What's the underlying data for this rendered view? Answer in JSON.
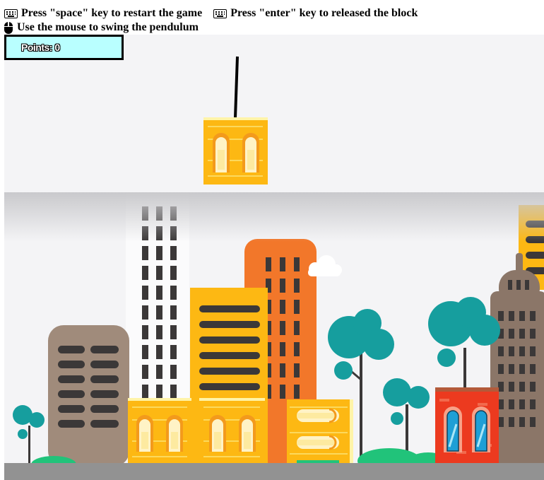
{
  "instructions": {
    "restart": "Press \"space\" key to restart the game",
    "release": "Press \"enter\" key to released the block",
    "swing": "Use the mouse to swing the pendulum"
  },
  "icons": {
    "keyboard": "keyboard-icon",
    "mouse": "mouse-icon"
  },
  "score": {
    "label": "Points: 0",
    "value": 0
  },
  "colors": {
    "score_bg": "#b9ffff",
    "sky": "#f4f4f6",
    "ground": "#929292",
    "block_yellow": "#fdb813",
    "block_red": "#ec3a1f",
    "building_orange": "#f2772a",
    "building_brown": "#a08b7b",
    "tree_teal": "#169e9e"
  },
  "stacked_blocks": [
    {
      "style": "window-block",
      "color": "yellow"
    },
    {
      "style": "window-block",
      "color": "yellow"
    },
    {
      "style": "capsule-block",
      "color": "yellow"
    }
  ],
  "swinging_block": {
    "style": "window-block",
    "color": "yellow"
  },
  "background_block": {
    "style": "window-block",
    "color": "red"
  }
}
